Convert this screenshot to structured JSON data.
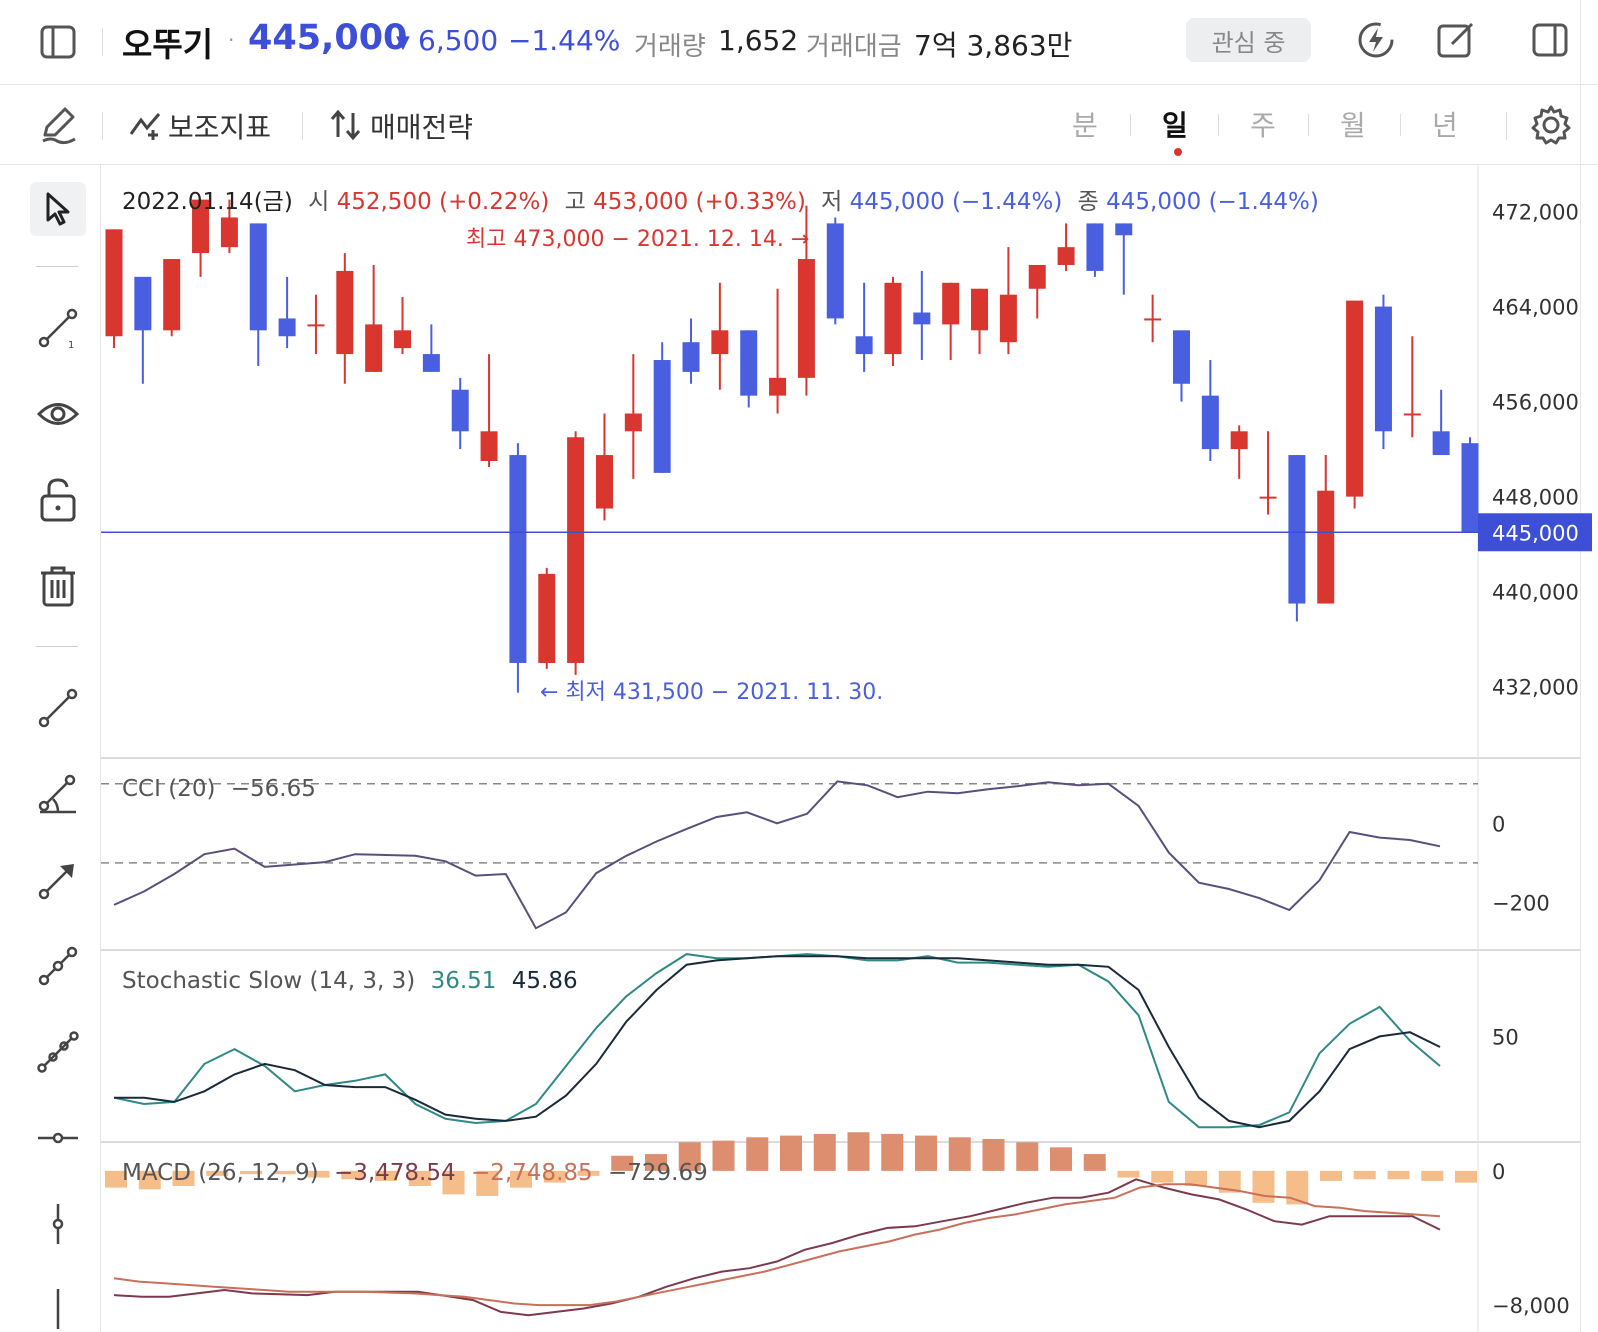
{
  "header": {
    "name": "오뚜기",
    "price": "445,000",
    "change_arrow": "▼",
    "change": "6,500",
    "change_pct": "−1.44%",
    "volume_label": "거래량",
    "volume": "1,652",
    "amount_label": "거래대금",
    "amount": "7억 3,863만",
    "watch_label": "관심 중"
  },
  "toolbar": {
    "indicators_label": "보조지표",
    "strategy_label": "매매전략",
    "periods": [
      "분",
      "일",
      "주",
      "월",
      "년"
    ],
    "active_period": "일"
  },
  "ohlc": {
    "date": "2022.01.14(금)",
    "open_label": "시",
    "open": "452,500 (+0.22%)",
    "high_label": "고",
    "high": "453,000 (+0.33%)",
    "low_label": "저",
    "low": "445,000 (−1.44%)",
    "close_label": "종",
    "close": "445,000 (−1.44%)"
  },
  "annotations": {
    "max": "최고 473,000 − 2021. 12. 14. →",
    "min": "← 최저 431,500 − 2021. 11. 30."
  },
  "indicators": {
    "cci_label": "CCI (20)",
    "cci_value": "−56.65",
    "stoch_label": "Stochastic Slow (14, 3, 3)",
    "stoch_k": "36.51",
    "stoch_d": "45.86",
    "macd_label": "MACD (26, 12, 9)",
    "macd_value": "−3,478.54",
    "macd_signal": "−2,748.85",
    "macd_hist": "−729.69"
  },
  "colors": {
    "up": "#d8362f",
    "down": "#4a5fdf",
    "price_line": "#3d4fd6",
    "cci": "#5a4f7c",
    "stoch_k": "#2f8a86",
    "stoch_d": "#1a2a3a",
    "macd": "#7c3a4e",
    "signal": "#c8705a",
    "hist_pos": "#dc8e6e",
    "hist_neg": "#f5bd8a"
  },
  "chart_data": [
    {
      "type": "candlestick",
      "title": "",
      "ylim": [
        426000,
        476000
      ],
      "y_ticks": [
        "472,000",
        "464,000",
        "456,000",
        "448,000",
        "440,000",
        "432,000"
      ],
      "y_tick_values": [
        472000,
        464000,
        456000,
        448000,
        440000,
        432000
      ],
      "current_price": 445000,
      "current_price_label": "445,000",
      "candles": [
        {
          "o": 461500,
          "h": 467800,
          "l": 460500,
          "c": 470500
        },
        {
          "o": 466500,
          "h": 466000,
          "l": 457500,
          "c": 462000
        },
        {
          "o": 462000,
          "h": 468000,
          "l": 461500,
          "c": 468000
        },
        {
          "o": 468500,
          "h": 473000,
          "l": 466500,
          "c": 473000
        },
        {
          "o": 469000,
          "h": 473000,
          "l": 468500,
          "c": 471500
        },
        {
          "o": 471000,
          "h": 471000,
          "l": 459000,
          "c": 462000
        },
        {
          "o": 463000,
          "h": 466500,
          "l": 460500,
          "c": 461500
        },
        {
          "o": 462500,
          "h": 465000,
          "l": 460000,
          "c": 462500
        },
        {
          "o": 460000,
          "h": 468500,
          "l": 457500,
          "c": 467000
        },
        {
          "o": 458500,
          "h": 467500,
          "l": 458500,
          "c": 462500
        },
        {
          "o": 460500,
          "h": 464800,
          "l": 460000,
          "c": 462000
        },
        {
          "o": 460000,
          "h": 462500,
          "l": 458500,
          "c": 458500
        },
        {
          "o": 457000,
          "h": 458000,
          "l": 452000,
          "c": 453500
        },
        {
          "o": 451000,
          "h": 460000,
          "l": 450500,
          "c": 453500
        },
        {
          "o": 451500,
          "h": 452500,
          "l": 431500,
          "c": 434000
        },
        {
          "o": 434000,
          "h": 442000,
          "l": 433500,
          "c": 441500
        },
        {
          "o": 434000,
          "h": 453500,
          "l": 433000,
          "c": 453000
        },
        {
          "o": 447000,
          "h": 455000,
          "l": 446000,
          "c": 451500
        },
        {
          "o": 453500,
          "h": 460000,
          "l": 449500,
          "c": 455000
        },
        {
          "o": 459500,
          "h": 461000,
          "l": 450000,
          "c": 450000
        },
        {
          "o": 461000,
          "h": 463000,
          "l": 457500,
          "c": 458500
        },
        {
          "o": 460000,
          "h": 466000,
          "l": 457000,
          "c": 462000
        },
        {
          "o": 462000,
          "h": 462000,
          "l": 455500,
          "c": 456500
        },
        {
          "o": 456500,
          "h": 465500,
          "l": 455000,
          "c": 458000
        },
        {
          "o": 458000,
          "h": 472500,
          "l": 456500,
          "c": 468000
        },
        {
          "o": 471000,
          "h": 471500,
          "l": 462500,
          "c": 463000
        },
        {
          "o": 461500,
          "h": 466000,
          "l": 458500,
          "c": 460000
        },
        {
          "o": 460000,
          "h": 466500,
          "l": 459000,
          "c": 466000
        },
        {
          "o": 463500,
          "h": 467000,
          "l": 459500,
          "c": 462500
        },
        {
          "o": 462500,
          "h": 465500,
          "l": 459500,
          "c": 466000
        },
        {
          "o": 462000,
          "h": 465500,
          "l": 460000,
          "c": 465500
        },
        {
          "o": 461000,
          "h": 469000,
          "l": 460000,
          "c": 465000
        },
        {
          "o": 465500,
          "h": 467000,
          "l": 463000,
          "c": 467500
        },
        {
          "o": 467500,
          "h": 471000,
          "l": 467000,
          "c": 469000
        },
        {
          "o": 471000,
          "h": 470000,
          "l": 466500,
          "c": 467000
        },
        {
          "o": 471000,
          "h": 470500,
          "l": 465000,
          "c": 470000
        },
        {
          "o": 463000,
          "h": 465000,
          "l": 461000,
          "c": 463000
        },
        {
          "o": 462000,
          "h": 462000,
          "l": 456000,
          "c": 457500
        },
        {
          "o": 456500,
          "h": 459500,
          "l": 451000,
          "c": 452000
        },
        {
          "o": 452000,
          "h": 454000,
          "l": 449500,
          "c": 453500
        },
        {
          "o": 448000,
          "h": 453500,
          "l": 446500,
          "c": 448000
        },
        {
          "o": 451500,
          "h": 451500,
          "l": 437500,
          "c": 439000
        },
        {
          "o": 439000,
          "h": 451500,
          "l": 439500,
          "c": 448500
        },
        {
          "o": 448000,
          "h": 464500,
          "l": 447000,
          "c": 464500
        },
        {
          "o": 464000,
          "h": 465000,
          "l": 452000,
          "c": 453500
        },
        {
          "o": 455000,
          "h": 461500,
          "l": 453000,
          "c": 455000
        },
        {
          "o": 453500,
          "h": 457000,
          "l": 451500,
          "c": 451500
        },
        {
          "o": 452500,
          "h": 453000,
          "l": 445000,
          "c": 445000
        }
      ]
    },
    {
      "type": "line",
      "title": "CCI (20)",
      "ylim": [
        -320,
        160
      ],
      "y_ticks": [
        "0",
        "−200"
      ],
      "y_tick_values": [
        0,
        -200
      ],
      "reference_lines": [
        100,
        -100
      ],
      "series": [
        {
          "name": "CCI (20)",
          "values": [
            -206,
            -172,
            -128,
            -78,
            -64,
            -110,
            -104,
            -98,
            -78,
            -80,
            -82,
            -96,
            -132,
            -128,
            -265,
            -225,
            -126,
            -82,
            -46,
            -14,
            16,
            28,
            0,
            24,
            106,
            96,
            66,
            80,
            76,
            86,
            94,
            104,
            96,
            100,
            44,
            -74,
            -150,
            -166,
            -189,
            -219,
            -144,
            -22,
            -36,
            -42,
            -58
          ]
        }
      ]
    },
    {
      "type": "line",
      "title": "Stochastic Slow (14, 3, 3)",
      "ylim": [
        0,
        90
      ],
      "y_ticks": [
        "50"
      ],
      "y_tick_values": [
        50
      ],
      "series": [
        {
          "name": "36.51",
          "values": [
            21,
            18,
            19,
            37,
            44,
            36,
            24,
            27,
            29,
            32,
            18,
            11,
            9,
            10,
            18,
            36,
            54,
            69,
            80,
            89,
            87,
            87,
            88,
            89,
            88,
            86,
            86,
            88,
            85,
            85,
            84,
            83,
            84,
            76,
            60,
            19,
            7,
            7,
            8,
            14,
            42,
            56,
            64,
            48,
            36
          ]
        },
        {
          "name": "45.86",
          "values": [
            21,
            21,
            19,
            24,
            32,
            37,
            34,
            27,
            26,
            26,
            20,
            13,
            11,
            10,
            12,
            22,
            37,
            57,
            72,
            84,
            86,
            87,
            88,
            88,
            88,
            87,
            87,
            87,
            87,
            86,
            85,
            84,
            84,
            83,
            72,
            45,
            21,
            10,
            7,
            10,
            24,
            44,
            50,
            52,
            45
          ]
        }
      ]
    },
    {
      "type": "bar+line",
      "title": "MACD (26, 12, 9)",
      "ylim": [
        -9600,
        1600
      ],
      "y_ticks": [
        "0",
        "−8,000"
      ],
      "y_tick_values": [
        0,
        -8000
      ],
      "series": [
        {
          "name": "−3,478.54",
          "values": [
            -7400,
            -7500,
            -7500,
            -7300,
            -7100,
            -7300,
            -7350,
            -7400,
            -7200,
            -7200,
            -7200,
            -7200,
            -7450,
            -7700,
            -8400,
            -8600,
            -8400,
            -8200,
            -7900,
            -7500,
            -6900,
            -6400,
            -6000,
            -5800,
            -5400,
            -4700,
            -4300,
            -3800,
            -3400,
            -3300,
            -3000,
            -2700,
            -2300,
            -1900,
            -1600,
            -1600,
            -1300,
            -500,
            -1000,
            -1400,
            -1700,
            -2300,
            -3000,
            -3200,
            -2700,
            -2700,
            -2700,
            -2700,
            -3500
          ]
        },
        {
          "name": "−2,748.85",
          "values": [
            -6400,
            -6600,
            -6700,
            -6800,
            -6900,
            -7000,
            -7100,
            -7200,
            -7200,
            -7200,
            -7200,
            -7250,
            -7300,
            -7400,
            -7500,
            -7700,
            -7900,
            -8000,
            -8000,
            -8000,
            -7800,
            -7500,
            -7200,
            -6900,
            -6600,
            -6300,
            -6000,
            -5600,
            -5200,
            -4800,
            -4500,
            -4200,
            -3800,
            -3500,
            -3100,
            -2800,
            -2600,
            -2300,
            -2000,
            -1800,
            -1600,
            -1000,
            -800,
            -800,
            -1000,
            -1200,
            -1500,
            -1600,
            -2100,
            -2200,
            -2400,
            -2500,
            -2600,
            -2700
          ]
        },
        {
          "name": "−729.69",
          "values": [
            -1000,
            -1100,
            -900,
            -300,
            -200,
            -200,
            -400,
            -500,
            -600,
            -900,
            -1400,
            -1500,
            -1000,
            -700,
            -300,
            900,
            1000,
            1700,
            1800,
            2000,
            2100,
            2200,
            2300,
            2200,
            2100,
            2000,
            1900,
            1700,
            1400,
            1000,
            -400,
            -700,
            -900,
            -1300,
            -1900,
            -2000,
            -600,
            -500,
            -500,
            -600,
            -700
          ]
        }
      ]
    }
  ]
}
